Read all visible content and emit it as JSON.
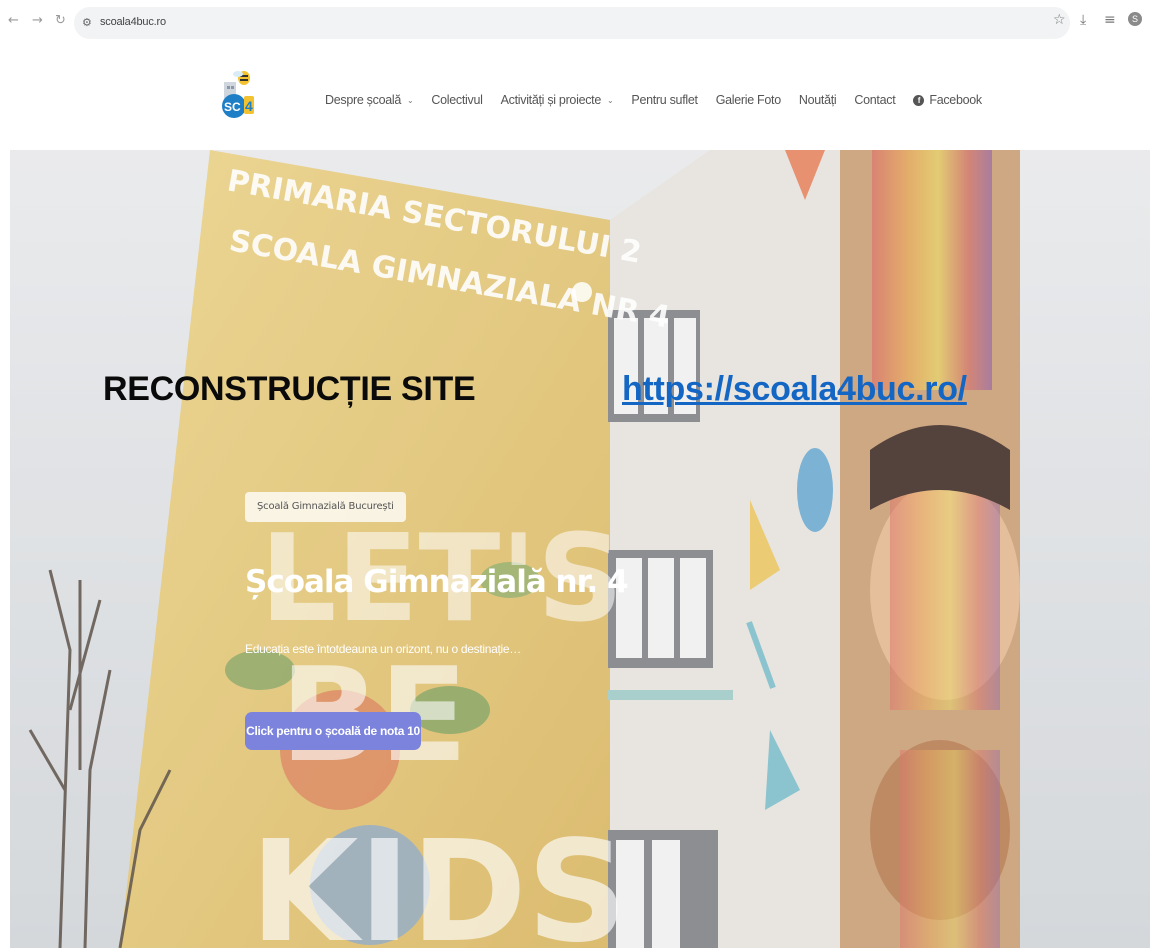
{
  "browser": {
    "back_icon": "arrow-left-icon",
    "forward_icon": "arrow-right-icon",
    "reload_icon": "reload-icon",
    "url": "scoala4buc.ro",
    "profile_initial": "S"
  },
  "header": {
    "logo_text": "SC4",
    "menu": [
      {
        "label": "Despre școală",
        "has_dropdown": true
      },
      {
        "label": "Colectivul",
        "has_dropdown": false
      },
      {
        "label": "Activități și proiecte",
        "has_dropdown": true
      },
      {
        "label": "Pentru suflet",
        "has_dropdown": false
      },
      {
        "label": "Galerie Foto",
        "has_dropdown": false
      },
      {
        "label": "Noutăți",
        "has_dropdown": false
      },
      {
        "label": "Contact",
        "has_dropdown": false
      },
      {
        "label": "Facebook",
        "has_dropdown": false
      }
    ]
  },
  "hero": {
    "building_sign": [
      "PRIMARIA SECTORULUI 2",
      "SCOALA GIMNAZIALA NR 4"
    ],
    "mural_words": [
      "LET'S",
      "BE",
      "KIDS"
    ],
    "tag": "Școală Gimnazială București",
    "title": "Școala Gimnazială nr. 4",
    "subtitle": "Educația este întotdeauna un orizont, nu o destinație…",
    "cta": "Click pentru o școală de nota 10",
    "cta_color": "#7b83dd"
  },
  "overlay": {
    "title": "RECONSTRUCȚIE SITE",
    "link": "https://scoala4buc.ro/"
  }
}
